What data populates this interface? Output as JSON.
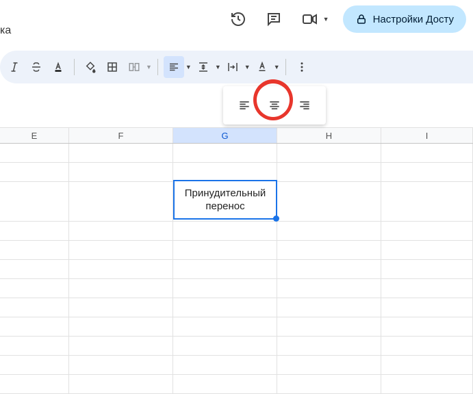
{
  "top": {
    "leftText": "ка",
    "shareLabel": "Настройки Досту"
  },
  "columns": {
    "e": "E",
    "f": "F",
    "g": "G",
    "h": "H",
    "i": "I"
  },
  "selectedCell": {
    "text": "Принудительный перенос"
  }
}
